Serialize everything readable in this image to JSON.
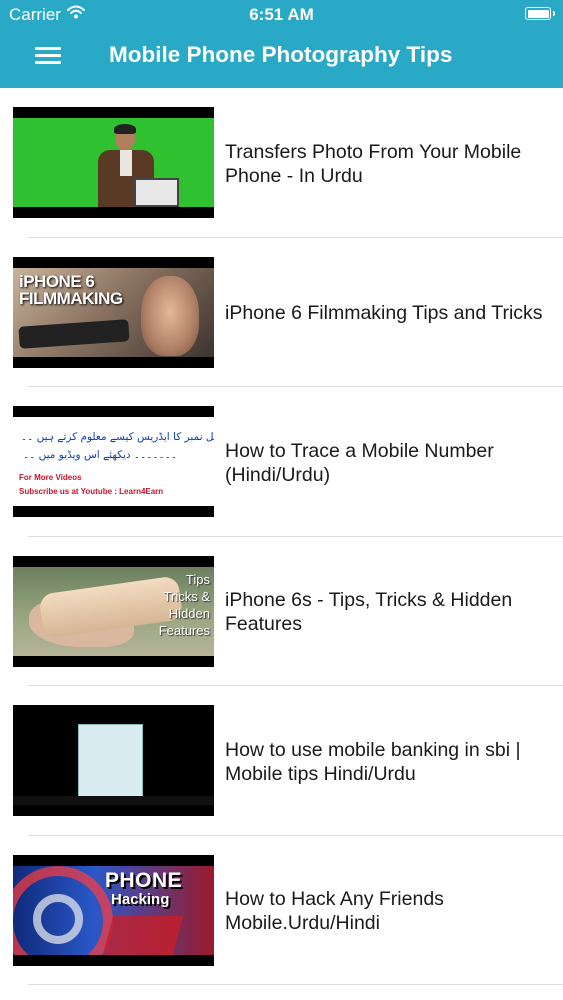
{
  "status_bar": {
    "carrier": "Carrier",
    "wifi_icon": "wifi-icon",
    "time": "6:51 AM",
    "battery_icon": "battery-full-icon"
  },
  "nav": {
    "menu_icon": "hamburger-menu-icon",
    "title": "Mobile Phone Photography Tips"
  },
  "colors": {
    "accent": "#2aa9c6",
    "text": "#1a1a1a",
    "separator": "#dddddd"
  },
  "videos": [
    {
      "title": "Transfers Photo From Your Mobile Phone - In Urdu"
    },
    {
      "title": "iPhone 6 Filmmaking Tips and Tricks",
      "thumb_text": "iPHONE 6 FILMMAKING"
    },
    {
      "title": "How to Trace a Mobile Number (Hindi/Urdu)",
      "thumb_urdu_1": "کسی بھی موبائل نمبر کا ایڈریس کیسے معلوم کرتے ہیں ۔۔",
      "thumb_urdu_2": "۔۔۔۔۔۔۔ دیکھئے اس ویڈیو میں ۔۔",
      "thumb_en_1": "For More Videos",
      "thumb_en_2": "Subscribe us at Youtube : Learn4Earn"
    },
    {
      "title": "iPhone 6s - Tips, Tricks & Hidden Features",
      "thumb_text": "Tips Tricks & Hidden Features"
    },
    {
      "title": "How to use mobile banking in sbi | Mobile tips Hindi/Urdu"
    },
    {
      "title": "How to Hack Any Friends Mobile.Urdu/Hindi",
      "thumb_text_1": "PHONE",
      "thumb_text_2": "Hacking"
    }
  ]
}
